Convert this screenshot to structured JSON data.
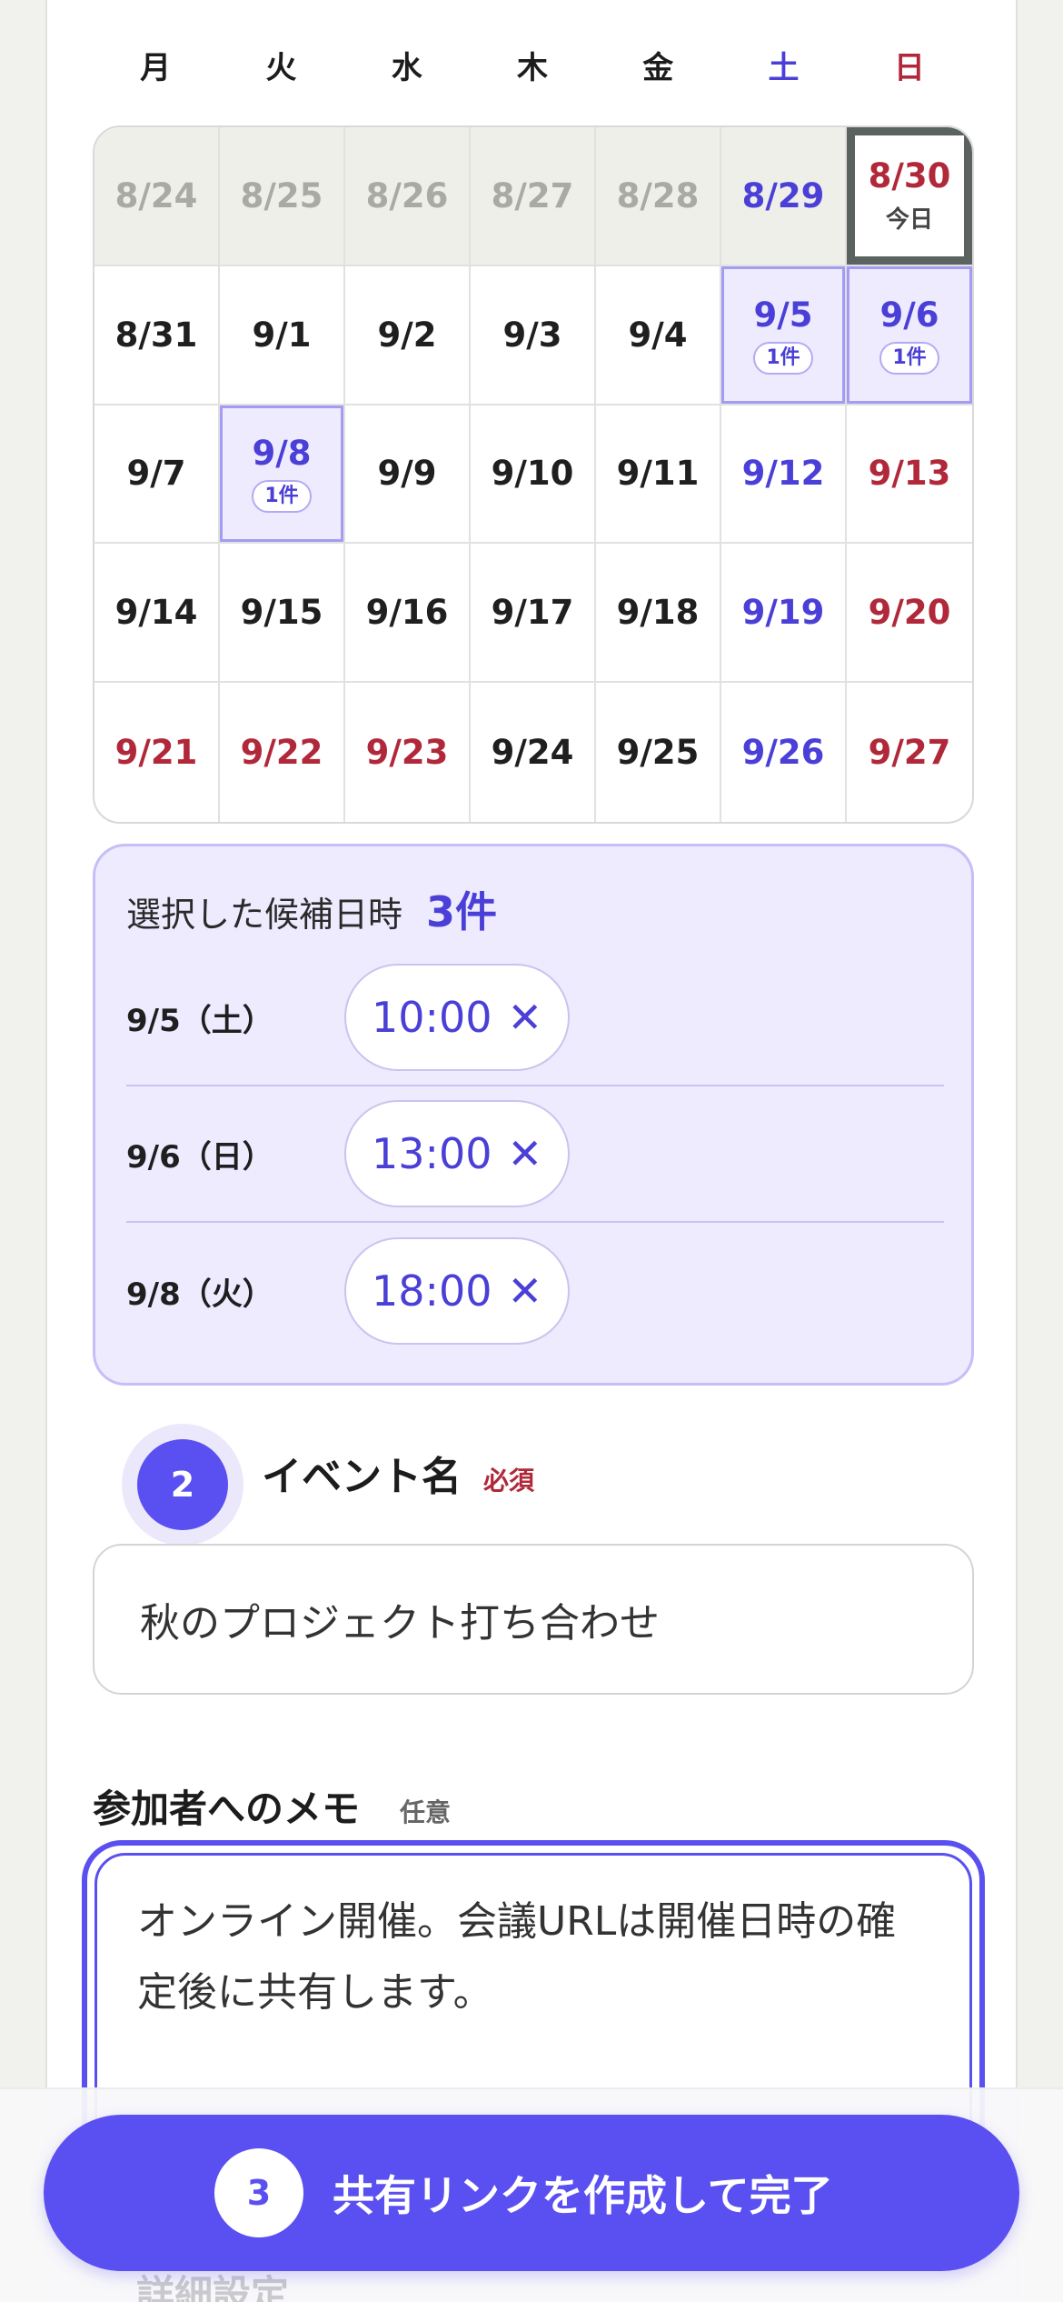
{
  "weekdays": [
    "月",
    "火",
    "水",
    "木",
    "金",
    "土",
    "日"
  ],
  "calendar": [
    {
      "date": "8/24"
    },
    {
      "date": "8/25"
    },
    {
      "date": "8/26"
    },
    {
      "date": "8/27"
    },
    {
      "date": "8/28"
    },
    {
      "date": "8/29"
    },
    {
      "date": "8/30",
      "sub": "今日"
    },
    {
      "date": "8/31"
    },
    {
      "date": "9/1"
    },
    {
      "date": "9/2"
    },
    {
      "date": "9/3"
    },
    {
      "date": "9/4"
    },
    {
      "date": "9/5",
      "badge": "1件"
    },
    {
      "date": "9/6",
      "badge": "1件"
    },
    {
      "date": "9/7"
    },
    {
      "date": "9/8",
      "badge": "1件"
    },
    {
      "date": "9/9"
    },
    {
      "date": "9/10"
    },
    {
      "date": "9/11"
    },
    {
      "date": "9/12"
    },
    {
      "date": "9/13"
    },
    {
      "date": "9/14"
    },
    {
      "date": "9/15"
    },
    {
      "date": "9/16"
    },
    {
      "date": "9/17"
    },
    {
      "date": "9/18"
    },
    {
      "date": "9/19"
    },
    {
      "date": "9/20"
    },
    {
      "date": "9/21"
    },
    {
      "date": "9/22"
    },
    {
      "date": "9/23"
    },
    {
      "date": "9/24"
    },
    {
      "date": "9/25"
    },
    {
      "date": "9/26"
    },
    {
      "date": "9/27"
    }
  ],
  "selected_panel": {
    "title": "選択した候補日時",
    "count": "3件",
    "slots": [
      {
        "date": "9/5（土）",
        "time": "10:00",
        "remove": "✕"
      },
      {
        "date": "9/6（日）",
        "time": "13:00",
        "remove": "✕"
      },
      {
        "date": "9/8（火）",
        "time": "18:00",
        "remove": "✕"
      }
    ]
  },
  "step2": {
    "number": "2",
    "label": "イベント名",
    "required": "必須"
  },
  "event_name": {
    "value": "秋のプロジェクト打ち合わせ"
  },
  "memo": {
    "label": "参加者へのメモ",
    "optional": "任意",
    "value": "オンライン開催。会議URLは開催日時の確定後に共有します。"
  },
  "cta": {
    "number": "3",
    "label": "共有リンクを作成して完了"
  },
  "below_fold_text": "詳細設定",
  "colors": {
    "accent": "#5a4ff0",
    "saturday": "#4a3fd6",
    "holiday": "#b0283a",
    "selected_bg": "#eeebff"
  }
}
